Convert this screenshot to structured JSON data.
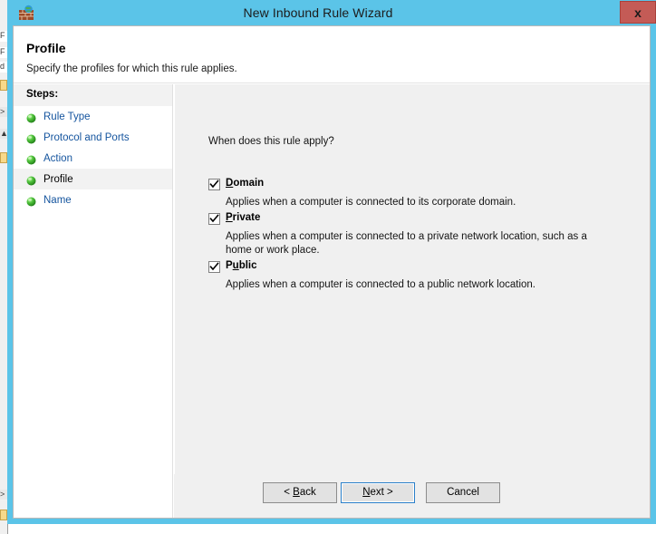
{
  "window": {
    "title": "New Inbound Rule Wizard",
    "icon": "firewall-brick-globe-icon",
    "close_label": "x",
    "accent_color": "#5bc4e8",
    "close_color": "#c45b56"
  },
  "header": {
    "title": "Profile",
    "subtitle": "Specify the profiles for which this rule applies."
  },
  "sidebar": {
    "heading": "Steps:",
    "items": [
      {
        "label": "Rule Type",
        "current": false,
        "bullet": "green-orb-icon"
      },
      {
        "label": "Protocol and Ports",
        "current": false,
        "bullet": "green-orb-icon"
      },
      {
        "label": "Action",
        "current": false,
        "bullet": "green-orb-icon"
      },
      {
        "label": "Profile",
        "current": true,
        "bullet": "green-orb-icon"
      },
      {
        "label": "Name",
        "current": false,
        "bullet": "green-orb-icon"
      }
    ],
    "link_color": "#14549e"
  },
  "content": {
    "question": "When does this rule apply?",
    "options": [
      {
        "label": "Domain",
        "accel_before": "",
        "accel": "D",
        "accel_after": "omain",
        "checked": true,
        "description": "Applies when a computer is connected to its corporate domain."
      },
      {
        "label": "Private",
        "accel_before": "",
        "accel": "P",
        "accel_after": "rivate",
        "checked": true,
        "description": "Applies when a computer is connected to a private network location, such as a home or work place."
      },
      {
        "label": "Public",
        "accel_before": "P",
        "accel": "u",
        "accel_after": "blic",
        "checked": true,
        "description": "Applies when a computer is connected to a public network location."
      }
    ]
  },
  "buttons": {
    "back": {
      "before": "< ",
      "accel": "B",
      "after": "ack",
      "focused": false
    },
    "next": {
      "before": "",
      "accel": "N",
      "after": "ext >",
      "focused": true
    },
    "cancel": {
      "before": "Cancel",
      "accel": "",
      "after": "",
      "focused": false
    }
  }
}
